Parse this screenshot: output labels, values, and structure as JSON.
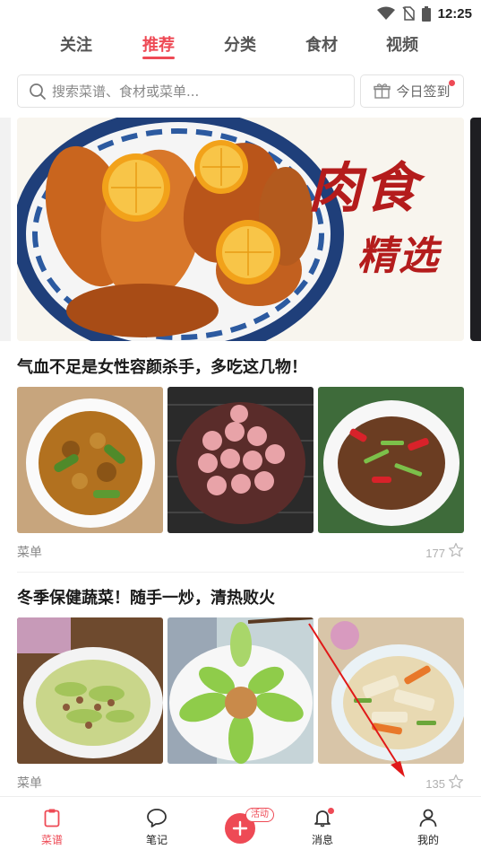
{
  "status_bar": {
    "time": "12:25"
  },
  "top_tabs": [
    {
      "label": "关注",
      "active": false
    },
    {
      "label": "推荐",
      "active": true
    },
    {
      "label": "分类",
      "active": false
    },
    {
      "label": "食材",
      "active": false
    },
    {
      "label": "视频",
      "active": false
    }
  ],
  "search": {
    "placeholder": "搜索菜谱、食材或菜单..."
  },
  "checkin": {
    "label": "今日签到"
  },
  "banner": {
    "line1": "肉食",
    "line2": "精选"
  },
  "cards": [
    {
      "title": "气血不足是女性容颜杀手，多吃这几物！",
      "tag": "菜单",
      "count": "177"
    },
    {
      "title": "冬季保健蔬菜！随手一炒，清热败火",
      "tag": "菜单",
      "count": "135"
    }
  ],
  "bottom_nav": {
    "items": [
      {
        "label": "菜谱",
        "active": true
      },
      {
        "label": "笔记",
        "active": false
      },
      {
        "label": "消息",
        "active": false
      },
      {
        "label": "我的",
        "active": false
      }
    ],
    "add_badge": "活动"
  },
  "colors": {
    "accent": "#ee4a55",
    "banner_text": "#b41c1c"
  }
}
